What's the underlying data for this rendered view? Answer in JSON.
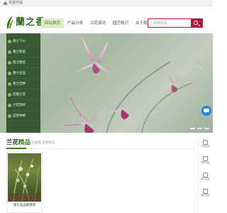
{
  "topbar": {
    "text": "欢迎光临"
  },
  "header": {
    "logo_text": "蘭之香",
    "nav": [
      {
        "label": "网站首页",
        "active": true
      },
      {
        "label": "产品分类",
        "active": false
      },
      {
        "label": "兰花资讯",
        "active": false
      },
      {
        "label": "园艺知识",
        "active": false
      },
      {
        "label": "关于我们",
        "active": false
      }
    ],
    "search": {
      "placeholder": "搜索商品"
    }
  },
  "sidebar": {
    "items": [
      {
        "label": "春兰下山"
      },
      {
        "label": "蕙兰新品"
      },
      {
        "label": "建兰精选"
      },
      {
        "label": "墨兰名品"
      },
      {
        "label": "寒兰佳种"
      },
      {
        "label": "莲瓣兰花"
      },
      {
        "label": "兰花资材"
      },
      {
        "label": "盆景种植"
      }
    ]
  },
  "banner": {
    "slides": 3,
    "active_slide": 0
  },
  "float_panel": {
    "items": [
      {
        "label": "在线咨询",
        "icon": "chat-icon"
      },
      {
        "label": "联系电话",
        "icon": "phone-icon"
      },
      {
        "label": "微信客服",
        "icon": "wechat-icon"
      },
      {
        "label": "返回顶部",
        "icon": "arrow-up-icon"
      }
    ]
  },
  "products_section": {
    "title_main": "兰花",
    "title_accent": "精品",
    "subtitle": "兰花推荐 品质保证",
    "items": [
      {
        "name": "建兰名品素荷花"
      }
    ]
  },
  "colors": {
    "brand_green": "#3d7a1c",
    "search_accent": "#b31a3b",
    "chat_blue": "#1e88e5",
    "sidebar_bg": "#264a22"
  }
}
